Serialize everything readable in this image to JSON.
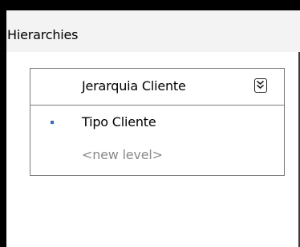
{
  "panel": {
    "title": "Hierarchies"
  },
  "hierarchy": {
    "name": "Jerarquia Cliente",
    "collapse_icon": "double-chevron-down-icon",
    "levels": [
      {
        "label": "Tipo Cliente"
      }
    ],
    "new_level_placeholder": "<new level>"
  },
  "colors": {
    "header_bg": "#f3f3f3",
    "border": "#7a7a7a",
    "level_dot": "#2f6bd9",
    "placeholder_text": "#8a8a8a"
  }
}
